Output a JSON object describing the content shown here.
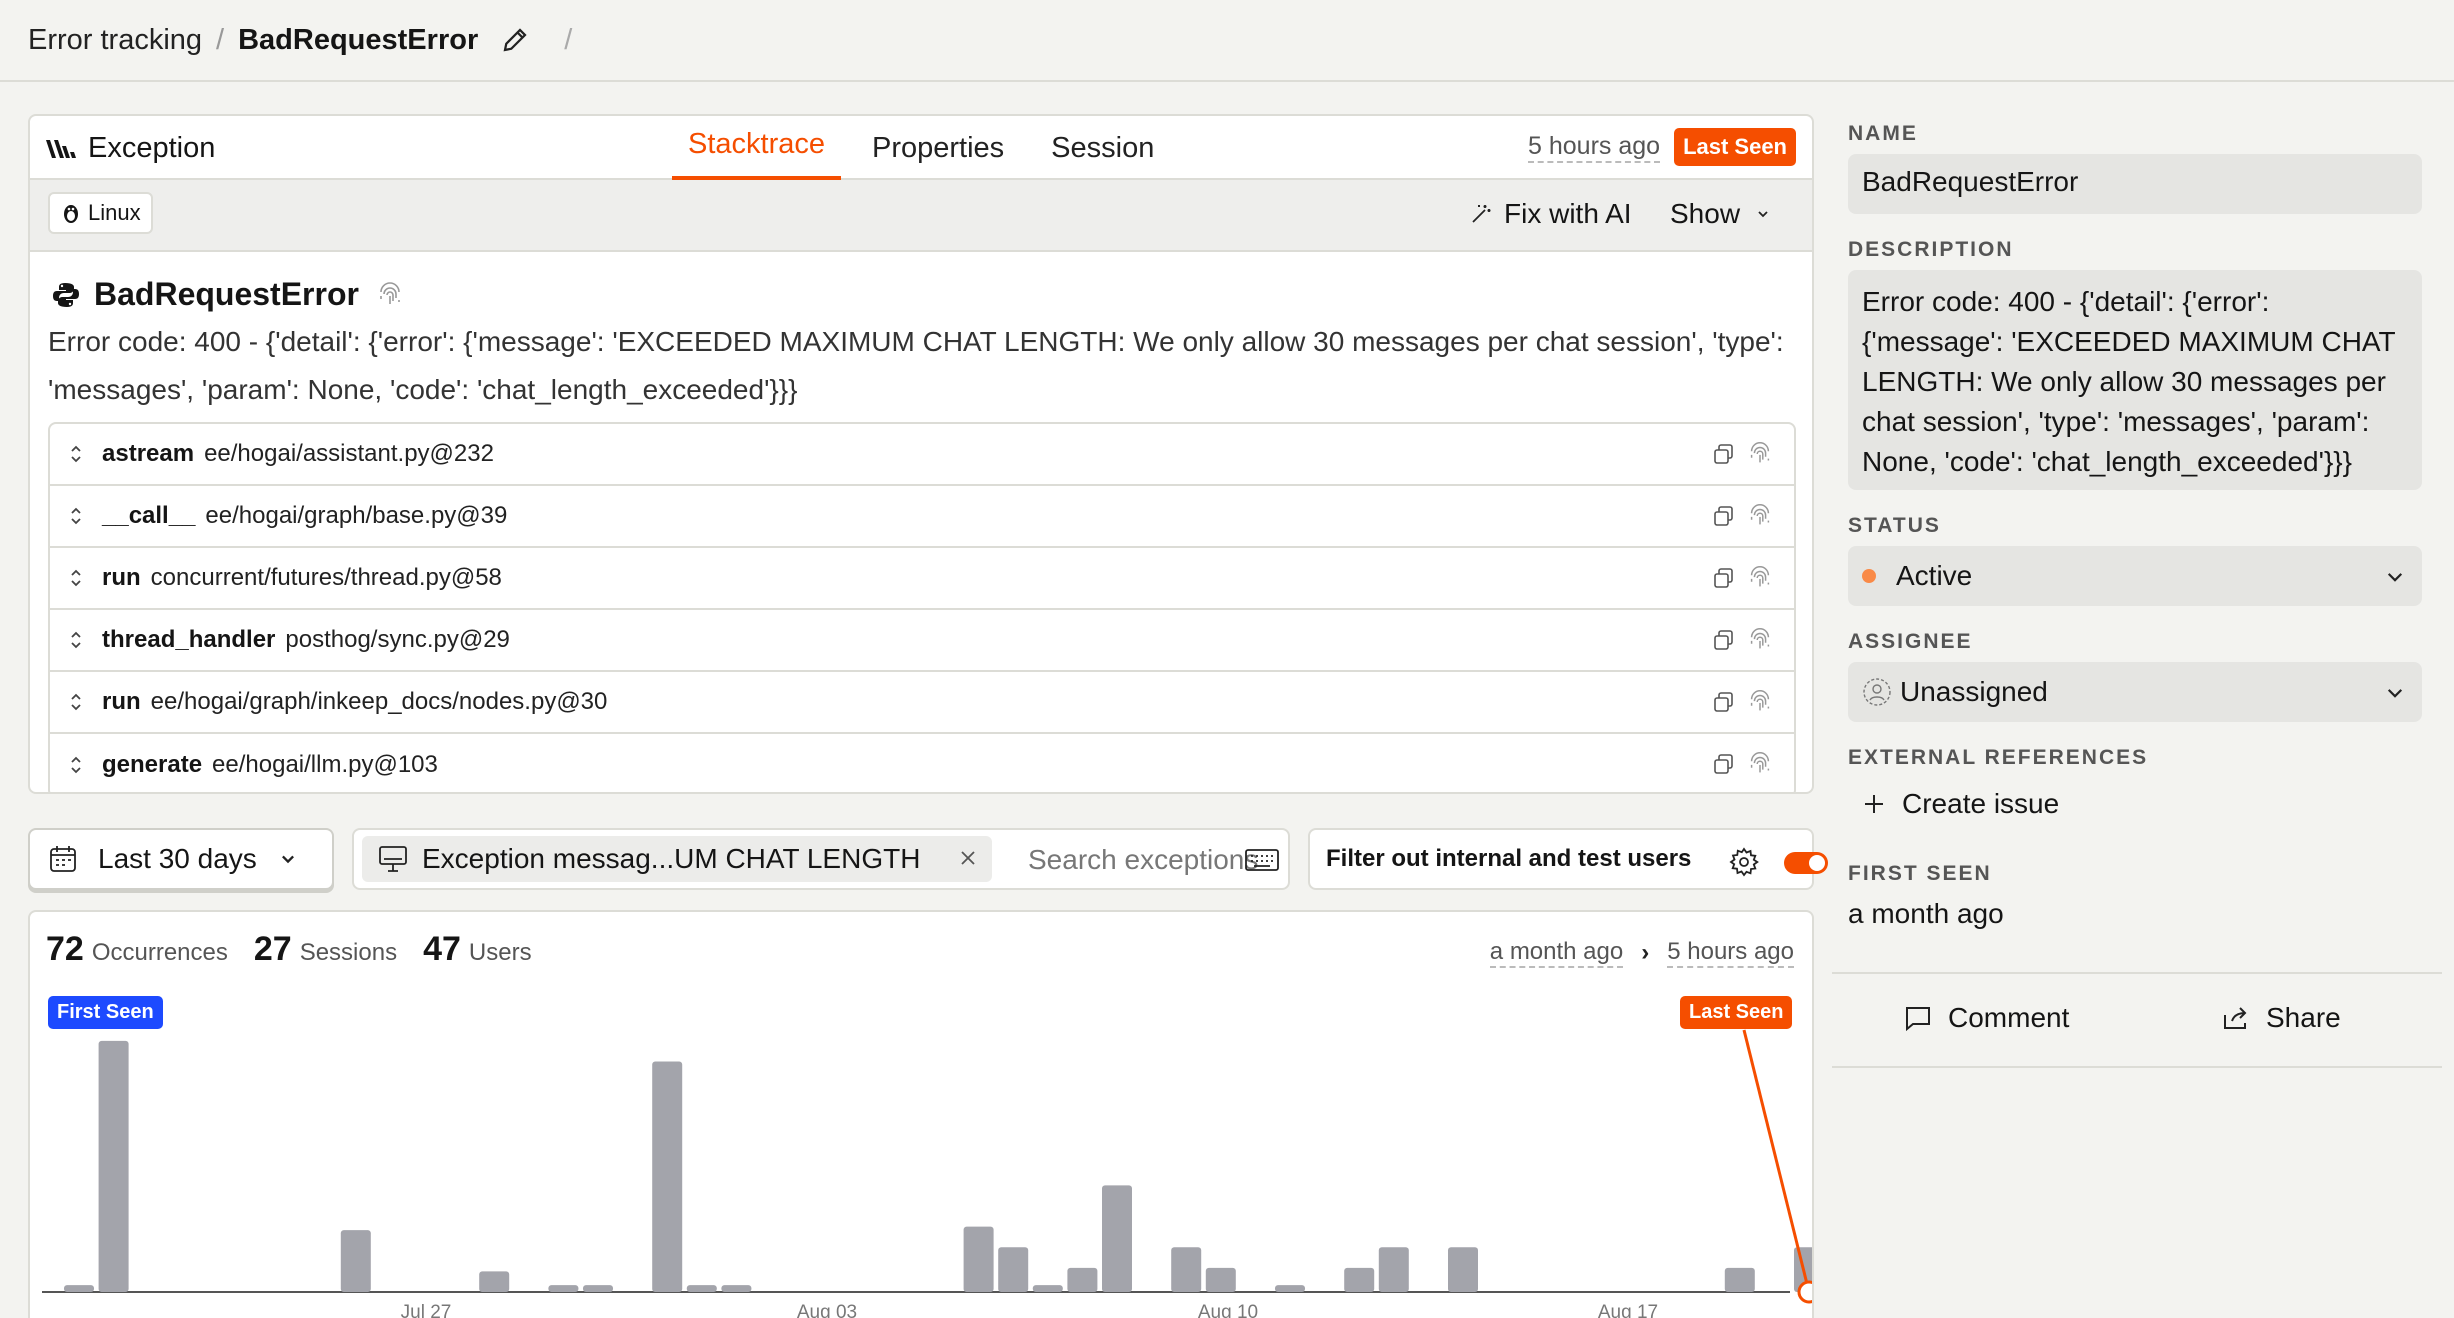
{
  "breadcrumb": {
    "parent": "Error tracking",
    "separator": "/",
    "current": "BadRequestError",
    "trailing_separator": "/"
  },
  "exception_panel": {
    "title": "Exception",
    "tabs": [
      {
        "label": "Stacktrace",
        "active": true
      },
      {
        "label": "Properties",
        "active": false
      },
      {
        "label": "Session",
        "active": false
      }
    ],
    "last_seen_ago": "5 hours ago",
    "last_seen_badge": "Last Seen",
    "os_tag": "Linux",
    "fix_ai_label": "Fix with AI",
    "show_label": "Show",
    "error_type": "BadRequestError",
    "error_message": "Error code: 400 - {'detail': {'error': {'message': 'EXCEEDED MAXIMUM CHAT LENGTH: We only allow 30 messages per chat session', 'type': 'messages', 'param': None, 'code': 'chat_length_exceeded'}}}",
    "frames": [
      {
        "fn": "astream",
        "path": "ee/hogai/assistant.py@232"
      },
      {
        "fn": "__call__",
        "path": "ee/hogai/graph/base.py@39"
      },
      {
        "fn": "run",
        "path": "concurrent/futures/thread.py@58"
      },
      {
        "fn": "thread_handler",
        "path": "posthog/sync.py@29"
      },
      {
        "fn": "run",
        "path": "ee/hogai/graph/inkeep_docs/nodes.py@30"
      },
      {
        "fn": "generate",
        "path": "ee/hogai/llm.py@103"
      }
    ]
  },
  "filters": {
    "date_range": "Last 30 days",
    "search_chip": "Exception messag...UM CHAT LENGTH",
    "search_placeholder": "Search exceptions",
    "internal_filter_label": "Filter out internal and test users",
    "internal_filter_on": true
  },
  "stats": {
    "occurrences": "72",
    "occurrences_label": "Occurrences",
    "sessions": "27",
    "sessions_label": "Sessions",
    "users": "47",
    "users_label": "Users",
    "range_start": "a month ago",
    "range_arrow": "›",
    "range_end": "5 hours ago",
    "first_seen_badge": "First Seen",
    "last_seen_badge": "Last Seen"
  },
  "chart_data": {
    "type": "bar",
    "x_tick_labels": [
      "Jul 27",
      "Aug 03",
      "Aug 10",
      "Aug 17"
    ],
    "values": [
      0.2,
      7.3,
      0,
      0,
      0,
      0,
      0,
      0,
      1.8,
      0,
      0,
      0,
      0.6,
      0,
      0.2,
      0.2,
      0,
      6.7,
      0.2,
      0.2,
      0,
      0,
      0,
      0,
      0,
      0,
      1.9,
      1.3,
      0.2,
      0.7,
      3.1,
      0,
      1.3,
      0.7,
      0,
      0.2,
      0,
      0.7,
      1.3,
      0,
      1.3,
      0,
      0,
      0,
      0,
      0,
      0,
      0,
      0.7,
      0,
      1.3
    ],
    "ylim": [
      0,
      7.5
    ],
    "colors": {
      "bar": "#a3a4ab",
      "first_seen": "#1d4aff",
      "last_seen": "#f54e00"
    }
  },
  "sidebar": {
    "name_label": "NAME",
    "name_value": "BadRequestError",
    "description_label": "DESCRIPTION",
    "description_value": "Error code: 400 - {'detail': {'error': {'message': 'EXCEEDED MAXIMUM CHAT LENGTH: We only allow 30 messages per chat session', 'type': 'messages', 'param': None, 'code': 'chat_length_exceeded'}}}",
    "status_label": "STATUS",
    "status_value": "Active",
    "assignee_label": "ASSIGNEE",
    "assignee_value": "Unassigned",
    "external_label": "EXTERNAL REFERENCES",
    "create_issue": "Create issue",
    "first_seen_label": "FIRST SEEN",
    "first_seen_value": "a month ago",
    "comment_label": "Comment",
    "share_label": "Share"
  },
  "colors": {
    "accent": "#f54e00",
    "first_seen": "#1d4aff",
    "background": "#f3f3f0"
  }
}
